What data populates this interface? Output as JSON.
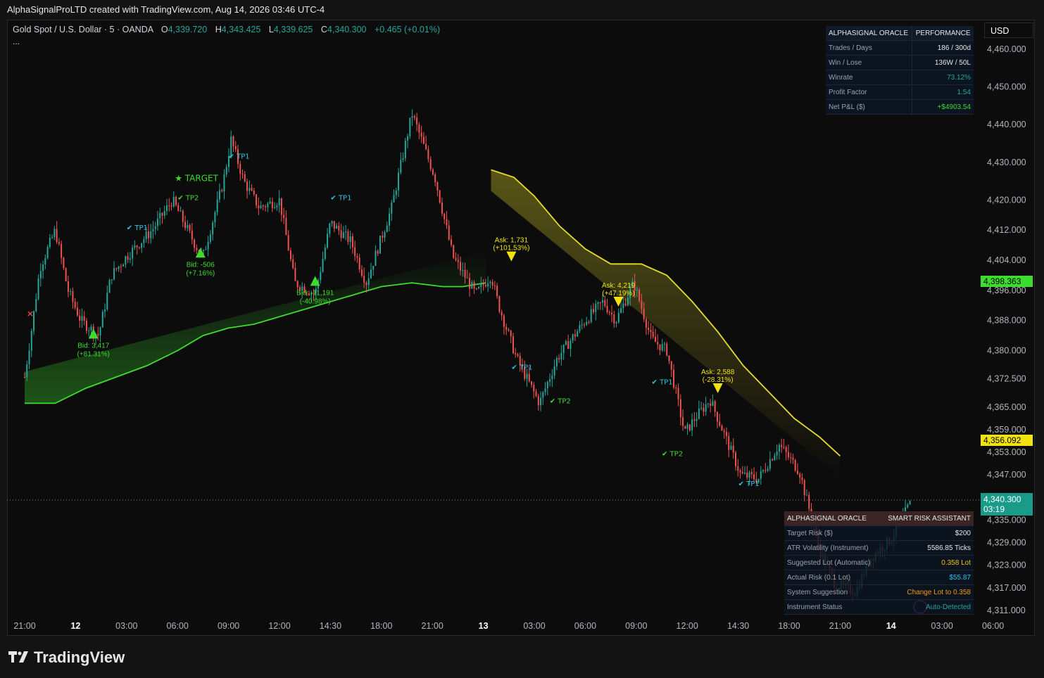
{
  "header": {
    "text": "AlphaSignalProLTD created with TradingView.com, Aug 14, 2026 03:46 UTC-4"
  },
  "legend": {
    "symbol": "Gold Spot / U.S. Dollar · 5 · OANDA",
    "o_label": "O",
    "o": "4,339.720",
    "h_label": "H",
    "h": "4,343.425",
    "l_label": "L",
    "l": "4,339.625",
    "c_label": "C",
    "c": "4,340.300",
    "change": "+0.465 (+0.01%)",
    "more": "..."
  },
  "currency": "USD",
  "colors": {
    "up": "#26a69a",
    "down": "#ef5350",
    "green_band": "#3ddc2f",
    "yellow_band": "#e5dc2a",
    "dotted_green": "#3ddc2f",
    "dotted_yellow": "#f2e30f",
    "tp_cyan": "#2ec4e6",
    "tp_green": "#3ddc2f",
    "bg": "#0c0c0c"
  },
  "perf_table": {
    "head": [
      "ALPHASIGNAL ORACLE",
      "PERFORMANCE"
    ],
    "rows": [
      {
        "k": "Trades / Days",
        "v": "186 / 300d",
        "color": "#e6e6e6"
      },
      {
        "k": "Win / Lose",
        "v": "136W / 50L",
        "color": "#e6e6e6"
      },
      {
        "k": "Winrate",
        "v": "73.12%",
        "color": "#26a69a"
      },
      {
        "k": "Profit Factor",
        "v": "1.54",
        "color": "#26a69a"
      },
      {
        "k": "Net P&L ($)",
        "v": "+$4903.54",
        "color": "#3ddc2f"
      }
    ]
  },
  "risk_table": {
    "head": [
      "ALPHASIGNAL ORACLE",
      "SMART RISK ASSISTANT"
    ],
    "rows": [
      {
        "k": "Target Risk ($)",
        "v": "$200",
        "color": "#e6e6e6"
      },
      {
        "k": "ATR Volatility (Instrument)",
        "v": "5586.85 Ticks",
        "color": "#e6e6e6"
      },
      {
        "k": "Suggested Lot (Automatic)",
        "v": "0.358 Lot",
        "color": "#f2c40f"
      },
      {
        "k": "Actual Risk (0.1 Lot)",
        "v": "$55.87",
        "color": "#2ec4e6"
      },
      {
        "k": "System Suggestion",
        "v": "Change Lot to 0.358",
        "color": "#f29a0f"
      },
      {
        "k": "Instrument Status",
        "v": "Auto-Detected",
        "color": "#26a69a"
      }
    ]
  },
  "price_tags": [
    {
      "label": "4,398.363",
      "bg": "#3ddc2f",
      "fg": "#000000"
    },
    {
      "label": "4,356.092",
      "bg": "#f2e30f",
      "fg": "#000000"
    },
    {
      "label": "4,340.300",
      "sub": "03:19",
      "bg": "#1a9b8a",
      "fg": "#ffffff"
    }
  ],
  "chart_data": {
    "type": "candlestick",
    "y_axis": {
      "ticks": [
        "4,460.000",
        "4,450.000",
        "4,440.000",
        "4,430.000",
        "4,420.000",
        "4,412.000",
        "4,404.000",
        "4,396.000",
        "4,388.000",
        "4,380.000",
        "4,372.500",
        "4,365.000",
        "4,359.000",
        "4,353.000",
        "4,347.000",
        "4,341.000",
        "4,335.000",
        "4,329.000",
        "4,323.000",
        "4,317.000",
        "4,311.000"
      ],
      "ylim": [
        4308,
        4466
      ]
    },
    "x_axis": {
      "ticks": [
        {
          "t": 0,
          "label": "21:00",
          "bold": false
        },
        {
          "t": 1,
          "label": "12",
          "bold": true
        },
        {
          "t": 2,
          "label": "03:00",
          "bold": false
        },
        {
          "t": 3,
          "label": "06:00",
          "bold": false
        },
        {
          "t": 4,
          "label": "09:00",
          "bold": false
        },
        {
          "t": 5,
          "label": "12:00",
          "bold": false
        },
        {
          "t": 6,
          "label": "14:30",
          "bold": false
        },
        {
          "t": 7,
          "label": "18:00",
          "bold": false
        },
        {
          "t": 8,
          "label": "21:00",
          "bold": false
        },
        {
          "t": 9,
          "label": "13",
          "bold": true
        },
        {
          "t": 10,
          "label": "03:00",
          "bold": false
        },
        {
          "t": 11,
          "label": "06:00",
          "bold": false
        },
        {
          "t": 12,
          "label": "09:00",
          "bold": false
        },
        {
          "t": 13,
          "label": "12:00",
          "bold": false
        },
        {
          "t": 14,
          "label": "14:30",
          "bold": false
        },
        {
          "t": 15,
          "label": "18:00",
          "bold": false
        },
        {
          "t": 16,
          "label": "21:00",
          "bold": false
        },
        {
          "t": 17,
          "label": "14",
          "bold": true
        },
        {
          "t": 18,
          "label": "03:00",
          "bold": false
        },
        {
          "t": 19,
          "label": "06:00",
          "bold": false
        }
      ]
    },
    "price_path": [
      [
        0,
        4373
      ],
      [
        0.12,
        4384
      ],
      [
        0.3,
        4402
      ],
      [
        0.6,
        4412
      ],
      [
        0.85,
        4396
      ],
      [
        1.1,
        4388
      ],
      [
        1.45,
        4384
      ],
      [
        1.7,
        4400
      ],
      [
        2.0,
        4405
      ],
      [
        2.5,
        4412
      ],
      [
        2.9,
        4420
      ],
      [
        3.35,
        4408
      ],
      [
        3.5,
        4405
      ],
      [
        3.9,
        4425
      ],
      [
        4.05,
        4436
      ],
      [
        4.3,
        4425
      ],
      [
        4.6,
        4418
      ],
      [
        5.0,
        4420
      ],
      [
        5.3,
        4398
      ],
      [
        5.7,
        4395
      ],
      [
        6.0,
        4414
      ],
      [
        6.4,
        4409
      ],
      [
        6.7,
        4398
      ],
      [
        7.2,
        4418
      ],
      [
        7.6,
        4443
      ],
      [
        8.05,
        4426
      ],
      [
        8.4,
        4405
      ],
      [
        8.85,
        4395
      ],
      [
        9.15,
        4400
      ],
      [
        9.3,
        4392
      ],
      [
        9.65,
        4378
      ],
      [
        10.1,
        4366
      ],
      [
        10.45,
        4378
      ],
      [
        11.0,
        4388
      ],
      [
        11.35,
        4393
      ],
      [
        11.6,
        4388
      ],
      [
        11.95,
        4398
      ],
      [
        12.3,
        4383
      ],
      [
        12.6,
        4380
      ],
      [
        12.95,
        4358
      ],
      [
        13.15,
        4362
      ],
      [
        13.45,
        4367
      ],
      [
        13.75,
        4357
      ],
      [
        14.05,
        4347
      ],
      [
        14.4,
        4346
      ],
      [
        14.8,
        4355
      ],
      [
        15.2,
        4348
      ],
      [
        15.6,
        4327
      ],
      [
        15.9,
        4318
      ],
      [
        16.3,
        4316
      ],
      [
        16.6,
        4325
      ],
      [
        17.0,
        4330
      ],
      [
        17.4,
        4340
      ]
    ],
    "candles_generated": true,
    "yellow_ma": [
      [
        9.15,
        4428
      ],
      [
        9.6,
        4426
      ],
      [
        10.0,
        4421
      ],
      [
        10.5,
        4413
      ],
      [
        11.0,
        4407
      ],
      [
        11.5,
        4403
      ],
      [
        12.1,
        4403
      ],
      [
        12.6,
        4400
      ],
      [
        13.1,
        4393
      ],
      [
        13.6,
        4385
      ],
      [
        14.1,
        4376
      ],
      [
        14.6,
        4369
      ],
      [
        15.1,
        4362
      ],
      [
        15.6,
        4357
      ],
      [
        16.0,
        4352
      ]
    ],
    "green_ma": [
      [
        0,
        4366
      ],
      [
        0.6,
        4366
      ],
      [
        1.2,
        4370
      ],
      [
        1.8,
        4373
      ],
      [
        2.4,
        4376
      ],
      [
        3.0,
        4380
      ],
      [
        3.5,
        4384
      ],
      [
        4.0,
        4386
      ],
      [
        4.5,
        4387
      ],
      [
        5.0,
        4389
      ],
      [
        5.5,
        4391
      ],
      [
        6.0,
        4393
      ],
      [
        6.5,
        4395
      ],
      [
        7.0,
        4397
      ],
      [
        7.6,
        4398
      ],
      [
        8.2,
        4397
      ],
      [
        8.6,
        4397
      ],
      [
        9.05,
        4398
      ]
    ],
    "markers": [
      {
        "kind": "buy",
        "x": 1.35,
        "y": 4384.5,
        "text": "Bid: 3,417",
        "pct": "(+81.31%)"
      },
      {
        "kind": "buy",
        "x": 3.45,
        "y": 4406,
        "text": "Bid: -506",
        "pct": "(+7.16%)"
      },
      {
        "kind": "buy",
        "x": 5.7,
        "y": 4398.5,
        "text": "Bid: -11,191",
        "pct": "(-40.98%)"
      },
      {
        "kind": "sell",
        "x": 9.55,
        "y": 4405,
        "text": "Ask: 1,731",
        "pct": "(+101.53%)"
      },
      {
        "kind": "sell",
        "x": 11.65,
        "y": 4393,
        "text": "Ask: 4,219",
        "pct": "(+47.19%)"
      },
      {
        "kind": "sell",
        "x": 13.6,
        "y": 4370,
        "text": "Ask: 2,588",
        "pct": "(-28.31%)"
      }
    ],
    "tp_labels": [
      {
        "x": 2.0,
        "y": 4412,
        "text": "✔ TP1",
        "color": "#2ec4e6"
      },
      {
        "x": 3.0,
        "y": 4420,
        "text": "✔ TP2",
        "color": "#3ddc2f"
      },
      {
        "x": 4.0,
        "y": 4431,
        "text": "✔ TP1",
        "color": "#2ec4e6"
      },
      {
        "x": 6.0,
        "y": 4420,
        "text": "✔ TP1",
        "color": "#2ec4e6"
      },
      {
        "x": 9.55,
        "y": 4375,
        "text": "✔ TP1",
        "color": "#2ec4e6"
      },
      {
        "x": 10.3,
        "y": 4366,
        "text": "✔ TP2",
        "color": "#3ddc2f"
      },
      {
        "x": 12.3,
        "y": 4371,
        "text": "✔ TP1",
        "color": "#2ec4e6"
      },
      {
        "x": 12.5,
        "y": 4352,
        "text": "✔ TP2",
        "color": "#3ddc2f"
      },
      {
        "x": 14.0,
        "y": 4344,
        "text": "✔ TP1",
        "color": "#2ec4e6"
      }
    ],
    "target": {
      "x": 3.0,
      "y": 4425,
      "text": "★ TARGET"
    },
    "exit_marker": {
      "x": 0.15,
      "y": 4389,
      "text": "✕"
    }
  }
}
